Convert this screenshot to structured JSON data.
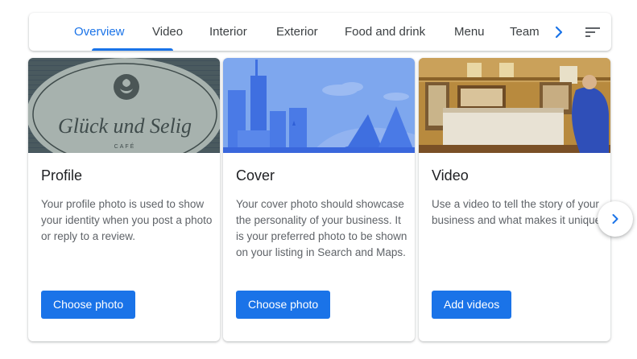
{
  "tabs": [
    {
      "label": "Overview",
      "active": true
    },
    {
      "label": "Video",
      "active": false
    },
    {
      "label": "Interior",
      "active": false
    },
    {
      "label": "Exterior",
      "active": false
    },
    {
      "label": "Food and drink",
      "active": false
    },
    {
      "label": "Menu",
      "active": false
    },
    {
      "label": "Team",
      "active": false
    }
  ],
  "tab_icons": {
    "next": "chevron-right-icon",
    "sort": "sort-icon"
  },
  "cards": [
    {
      "title": "Profile",
      "description": "Your profile photo is used to show your identity when you post a photo or reply to a review.",
      "button_label": "Choose photo",
      "image": {
        "kind": "cafe-sign-photo",
        "sign_text": "Glück und Selig",
        "sign_subtext": "CAFÉ"
      }
    },
    {
      "title": "Cover",
      "description": "Your cover photo should showcase the personality of your business. It is your preferred photo to be shown on your listing in Search and Maps.",
      "button_label": "Choose photo",
      "image": {
        "kind": "city-skyline-illustration"
      }
    },
    {
      "title": "Video",
      "description": "Use a video to tell the story of your business and what makes it unique.",
      "button_label": "Add videos",
      "image": {
        "kind": "shop-interior-photo"
      }
    }
  ],
  "carousel_icons": {
    "next": "chevron-right-icon"
  },
  "colors": {
    "accent": "#1a73e8",
    "text": "#202124",
    "secondary_text": "#5f6368",
    "tab_text": "#3c4043"
  }
}
